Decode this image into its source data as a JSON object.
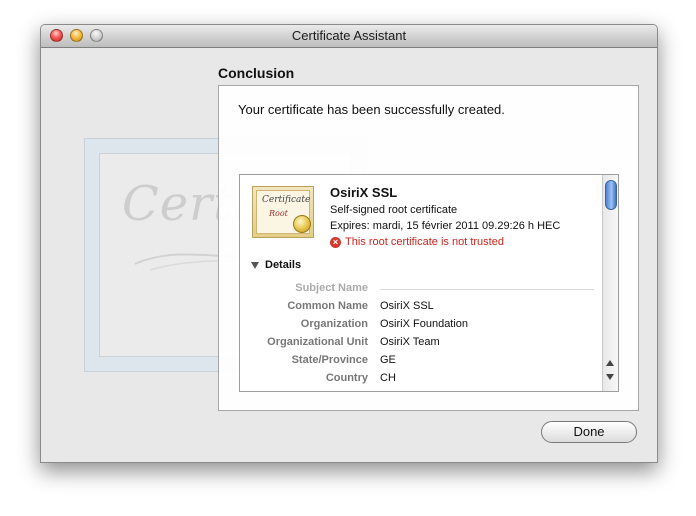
{
  "window": {
    "title": "Certificate Assistant"
  },
  "background_art": {
    "word": "Certif"
  },
  "section_heading": "Conclusion",
  "message": "Your certificate has been successfully created.",
  "certificate": {
    "icon": {
      "word": "Certificate",
      "sub": "Root"
    },
    "name": "OsiriX SSL",
    "type": "Self-signed root certificate",
    "expires": "Expires: mardi, 15 février 2011 09.29:26 h HEC",
    "warning": "This root certificate is not trusted",
    "details_label": "Details",
    "details": [
      {
        "label": "Subject Name",
        "value": ""
      },
      {
        "label": "Common Name",
        "value": "OsiriX SSL"
      },
      {
        "label": "Organization",
        "value": "OsiriX Foundation"
      },
      {
        "label": "Organizational Unit",
        "value": "OsiriX Team"
      },
      {
        "label": "State/Province",
        "value": "GE"
      },
      {
        "label": "Country",
        "value": "CH"
      }
    ]
  },
  "buttons": {
    "done": "Done"
  },
  "colors": {
    "warning": "#c8261a",
    "scroll_thumb": "#4d82d3"
  }
}
